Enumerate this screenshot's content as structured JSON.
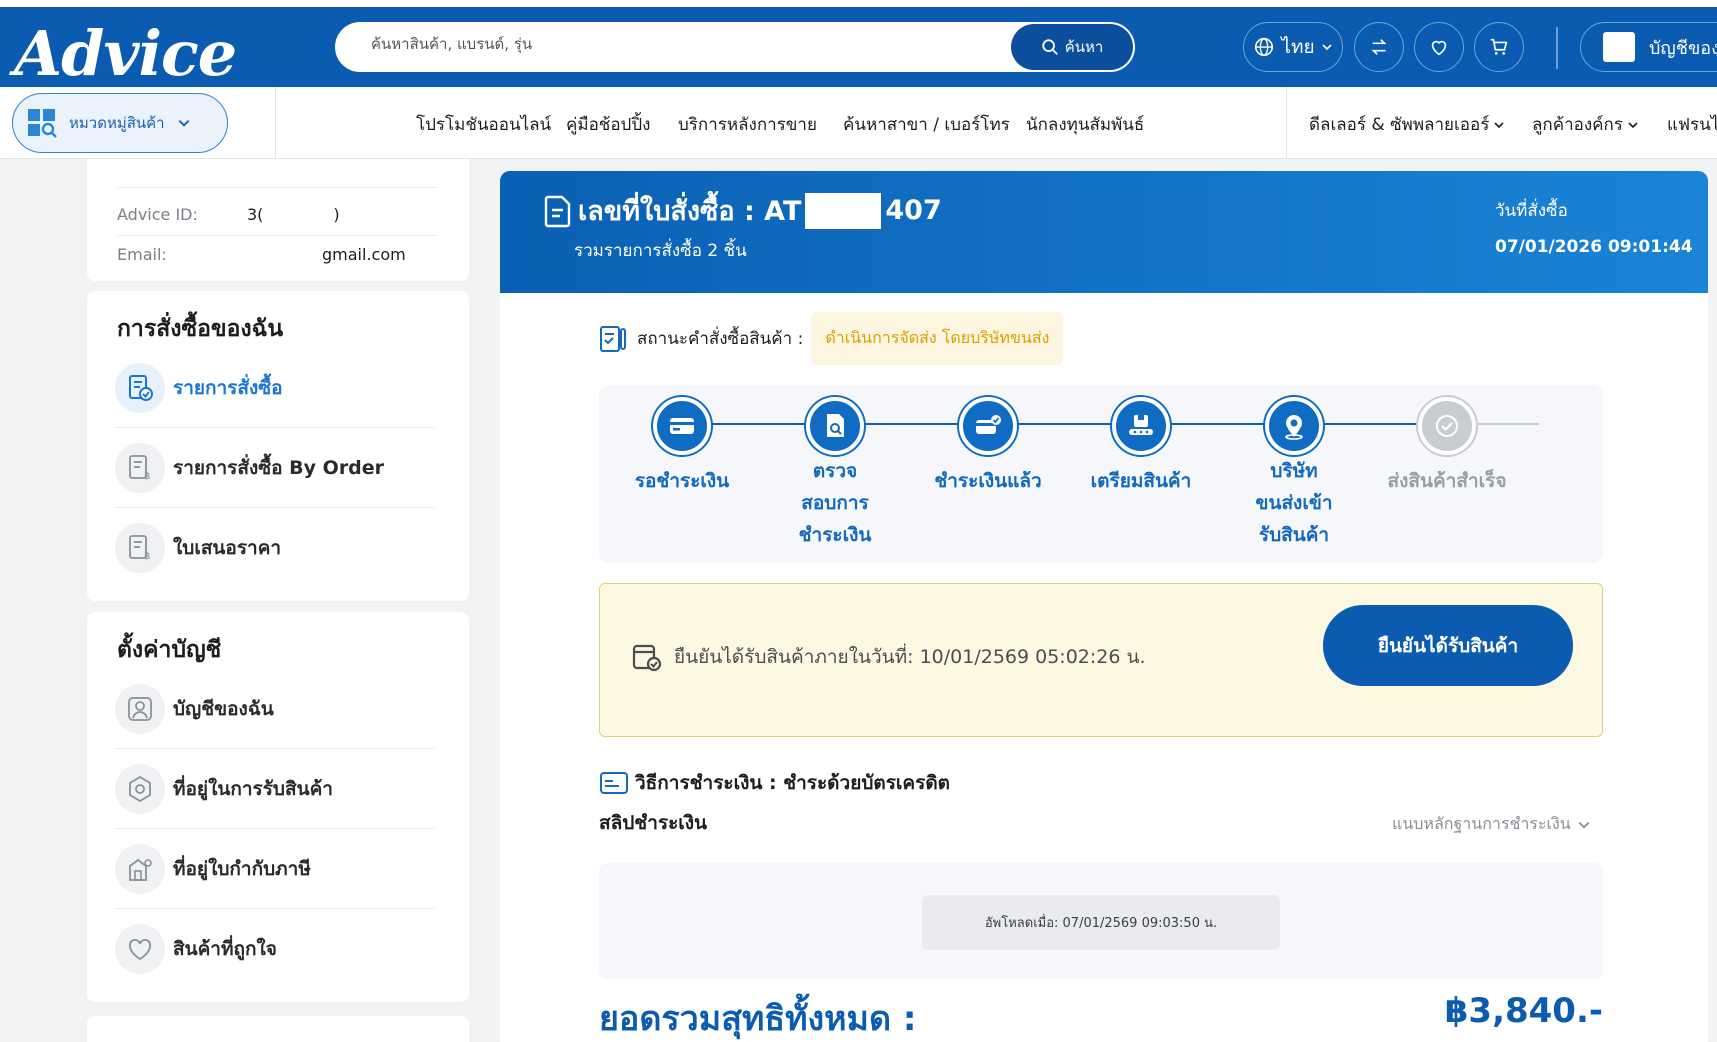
{
  "header": {
    "logo": "Advice",
    "search_placeholder": "ค้นหาสินค้า, แบรนด์, รุ่น",
    "search_button": "ค้นหา",
    "language": "ไทย",
    "account": "บัญชีของ"
  },
  "nav": {
    "category": "หมวดหมู่สินค้า",
    "items": [
      "โปรโมชันออนไลน์",
      "คู่มือช้อปปิ้ง",
      "บริการหลังการขาย",
      "ค้นหาสาขา / เบอร์โทร",
      "นักลงทุนสัมพันธ์"
    ],
    "right_items": [
      "ดีลเลอร์ & ซัพพลายเออร์",
      "ลูกค้าองค์กร",
      "แฟรนไ"
    ]
  },
  "profile": {
    "id_label": "Advice ID:",
    "id_value": "3(",
    "id_value_end": ")",
    "email_label": "Email:",
    "email_value": "gmail.com"
  },
  "orders_section": {
    "title": "การสั่งซื้อของฉัน",
    "items": [
      {
        "label": "รายการสั่งซื้อ",
        "icon": "order-list-icon",
        "active": true
      },
      {
        "label": "รายการสั่งซื้อ By Order",
        "icon": "receipt-icon",
        "active": false
      },
      {
        "label": "ใบเสนอราคา",
        "icon": "quotation-icon",
        "active": false
      }
    ]
  },
  "account_section": {
    "title": "ตั้งค่าบัญชี",
    "items": [
      {
        "label": "บัญชีของฉัน",
        "icon": "user-icon"
      },
      {
        "label": "ที่อยู่ในการรับสินค้า",
        "icon": "location-icon"
      },
      {
        "label": "ที่อยู่ใบกำกับภาษี",
        "icon": "building-icon"
      },
      {
        "label": "สินค้าที่ถูกใจ",
        "icon": "heart-icon"
      }
    ]
  },
  "order": {
    "number_label": "เลขที่ใบสั่งซื้อ : AT",
    "number_suffix": "407",
    "summary": "รวมรายการสั่งซื้อ 2 ชิ้น",
    "date_label": "วันที่สั่งซื้อ",
    "date": "07/01/2026 09:01:44",
    "status_label": "สถานะคำสั่งซื้อสินค้า :",
    "status": "ดำเนินการจัดส่ง โดยบริษัทขนส่ง",
    "steps": [
      {
        "label_lines": [
          "รอชำระเงิน"
        ],
        "icon": "card-icon",
        "done": true
      },
      {
        "label_lines": [
          "ตรวจ",
          "สอบการ",
          "ชำระเงิน"
        ],
        "icon": "doc-search-icon",
        "done": true
      },
      {
        "label_lines": [
          "ชำระเงินแล้ว"
        ],
        "icon": "card-check-icon",
        "done": true
      },
      {
        "label_lines": [
          "เตรียมสินค้า"
        ],
        "icon": "box-icon",
        "done": true
      },
      {
        "label_lines": [
          "บริษัท",
          "ขนส่งเข้า",
          "รับสินค้า"
        ],
        "icon": "pin-icon",
        "done": true
      },
      {
        "label_lines": [
          "ส่งสินค้าสำเร็จ"
        ],
        "icon": "check-icon",
        "done": false
      }
    ],
    "confirm_text": "ยืนยันได้รับสินค้าภายในวันที่: 10/01/2569 05:02:26 น.",
    "confirm_button": "ยืนยันได้รับสินค้า",
    "payment_method": "วิธีการชำระเงิน : ชำระด้วยบัตรเครดิต",
    "slip_title": "สลิปชำระเงิน",
    "slip_toggle": "แนบหลักฐานการชำระเงิน",
    "upload_text": "อัพโหลดเมื่อ: 07/01/2569 09:03:50 น.",
    "total_label": "ยอดรวมสุทธิทั้งหมด :",
    "total_value": "฿3,840.-"
  }
}
